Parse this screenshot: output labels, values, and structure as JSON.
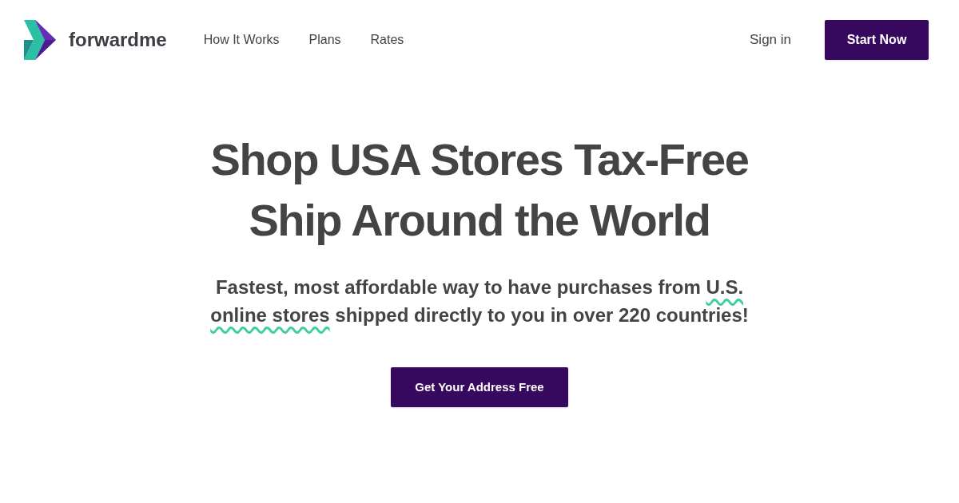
{
  "header": {
    "brand": "forwardme",
    "nav": [
      {
        "label": "How It Works"
      },
      {
        "label": "Plans"
      },
      {
        "label": "Rates"
      }
    ],
    "sign_in": "Sign in",
    "cta": "Start Now"
  },
  "hero": {
    "title_lines": [
      "Shop USA Stores Tax-Free",
      "Ship Around the World"
    ],
    "subtitle": {
      "before": "Fastest, most affordable way to have purchases from ",
      "highlight": "U.S. online stores",
      "after": " shipped directly to you in over 220 countries!"
    },
    "button": "Get Your Address Free"
  }
}
